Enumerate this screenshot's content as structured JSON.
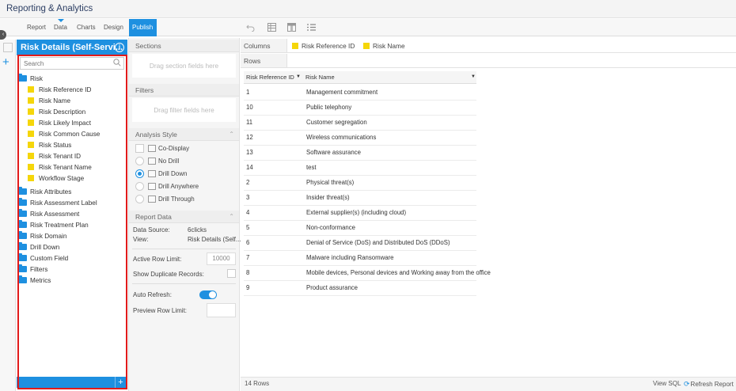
{
  "app": {
    "title": "Reporting & Analytics"
  },
  "tabs": [
    {
      "label": "Report"
    },
    {
      "label": "Data"
    },
    {
      "label": "Charts"
    },
    {
      "label": "Design"
    },
    {
      "label": "Publish"
    }
  ],
  "toolbar": {
    "icons": [
      "undo-icon",
      "table-icon",
      "pivot-icon",
      "list-icon"
    ]
  },
  "fields_panel": {
    "title": "Risk Details (Self-Servi...",
    "search_placeholder": "Search",
    "tree": [
      {
        "type": "folder",
        "label": "Risk"
      },
      {
        "type": "field",
        "label": "Risk Reference ID"
      },
      {
        "type": "field",
        "label": "Risk Name"
      },
      {
        "type": "field",
        "label": "Risk Description"
      },
      {
        "type": "field",
        "label": "Risk Likely Impact"
      },
      {
        "type": "field",
        "label": "Risk Common Cause"
      },
      {
        "type": "field",
        "label": "Risk Status"
      },
      {
        "type": "field",
        "label": "Risk Tenant ID"
      },
      {
        "type": "field",
        "label": "Risk Tenant Name"
      },
      {
        "type": "field",
        "label": "Workflow Stage"
      },
      {
        "type": "folder",
        "label": "Risk Attributes"
      },
      {
        "type": "folder",
        "label": "Risk Assessment Label"
      },
      {
        "type": "folder",
        "label": "Risk Assessment"
      },
      {
        "type": "folder",
        "label": "Risk Treatment Plan"
      },
      {
        "type": "folder",
        "label": "Risk Domain"
      },
      {
        "type": "folder",
        "label": "Drill Down"
      },
      {
        "type": "folder",
        "label": "Custom Field"
      },
      {
        "type": "folder",
        "label": "Filters"
      },
      {
        "type": "folder",
        "label": "Metrics"
      }
    ],
    "footer_add": "+"
  },
  "sections": {
    "title": "Sections",
    "placeholder": "Drag section fields here"
  },
  "filters": {
    "title": "Filters",
    "placeholder": "Drag filter fields here"
  },
  "analysis_style": {
    "title": "Analysis Style",
    "options": [
      {
        "label": "Co-Display"
      },
      {
        "label": "No Drill"
      },
      {
        "label": "Drill Down"
      },
      {
        "label": "Drill Anywhere"
      },
      {
        "label": "Drill Through"
      }
    ]
  },
  "report_data": {
    "title": "Report Data",
    "data_source_label": "Data Source:",
    "data_source_value": "6clicks",
    "view_label": "View:",
    "view_value": "Risk Details (Self...",
    "active_row_limit_label": "Active Row Limit:",
    "active_row_limit_value": "10000",
    "show_duplicates_label": "Show Duplicate Records:",
    "auto_refresh_label": "Auto Refresh:",
    "preview_row_limit_label": "Preview Row Limit:"
  },
  "shelves": {
    "columns_label": "Columns",
    "rows_label": "Rows",
    "column_fields": [
      {
        "label": "Risk Reference ID"
      },
      {
        "label": "Risk Name"
      }
    ]
  },
  "table": {
    "headers": [
      "Risk Reference ID",
      "Risk Name"
    ],
    "rows": [
      [
        "1",
        "Management commitment"
      ],
      [
        "10",
        "Public telephony"
      ],
      [
        "11",
        "Customer segregation"
      ],
      [
        "12",
        "Wireless communications"
      ],
      [
        "13",
        "Software assurance"
      ],
      [
        "14",
        "test"
      ],
      [
        "2",
        "Physical threat(s)"
      ],
      [
        "3",
        "Insider threat(s)"
      ],
      [
        "4",
        "External supplier(s) (including cloud)"
      ],
      [
        "5",
        "Non-conformance"
      ],
      [
        "6",
        "Denial of Service (DoS) and Distributed DoS (DDoS)"
      ],
      [
        "7",
        "Malware including Ransomware"
      ],
      [
        "8",
        "Mobile devices, Personal devices and Working away from the office"
      ],
      [
        "9",
        "Product assurance"
      ]
    ]
  },
  "status": {
    "row_count": "14 Rows",
    "view_sql": "View SQL",
    "refresh_report": "Refresh Report"
  },
  "colors": {
    "accent": "#1e90e0",
    "highlight_box": "#e21b1b",
    "field_icon": "#f5d60a"
  }
}
